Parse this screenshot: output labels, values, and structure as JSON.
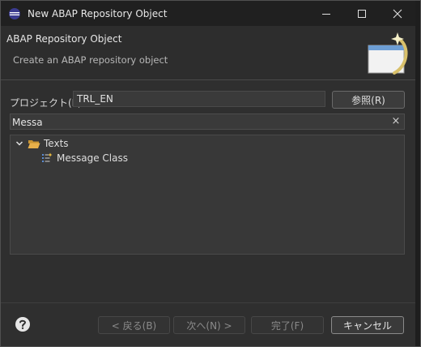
{
  "window": {
    "title": "New ABAP Repository Object"
  },
  "header": {
    "title": "ABAP Repository Object",
    "description": "Create an ABAP repository object"
  },
  "form": {
    "project_label": "プロジェクト(P):",
    "project_value": "TRL_EN",
    "browse_label": "参照(R)"
  },
  "search": {
    "value": "Messa",
    "clear_icon": "×"
  },
  "tree": {
    "items": [
      {
        "label": "Texts",
        "icon": "folder-open-icon",
        "expanded": true,
        "level": 0
      },
      {
        "label": "Message Class",
        "icon": "message-class-icon",
        "level": 1
      }
    ]
  },
  "footer": {
    "back_label": "< 戻る(B)",
    "next_label": "次へ(N) >",
    "finish_label": "完了(F)",
    "cancel_label": "キャンセル"
  },
  "colors": {
    "titlebar": "#202020",
    "background": "#2f2f2f",
    "folder": "#e8b04a",
    "accent": "#5b8ed6"
  }
}
